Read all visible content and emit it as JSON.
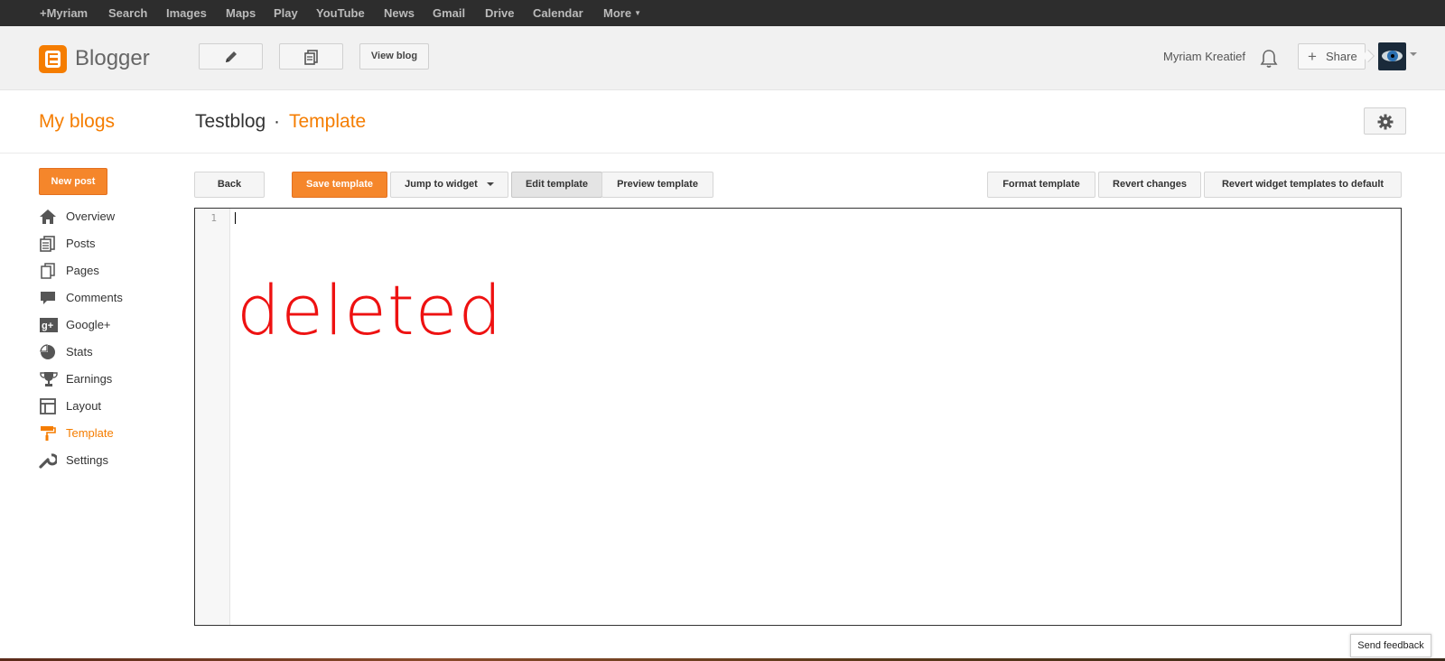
{
  "gbar": {
    "items": [
      "+Myriam",
      "Search",
      "Images",
      "Maps",
      "Play",
      "YouTube",
      "News",
      "Gmail",
      "Drive",
      "Calendar",
      "More"
    ]
  },
  "header": {
    "logo_text": "Blogger",
    "view_blog": "View blog",
    "user_name": "Myriam Kreatief",
    "share_label": "Share"
  },
  "title_row": {
    "my_blogs": "My blogs",
    "blog_name": "Testblog",
    "separator": "·",
    "section": "Template"
  },
  "sidebar": {
    "new_post": "New post",
    "items": [
      {
        "label": "Overview",
        "icon": "home-icon"
      },
      {
        "label": "Posts",
        "icon": "posts-icon"
      },
      {
        "label": "Pages",
        "icon": "pages-icon"
      },
      {
        "label": "Comments",
        "icon": "comment-icon"
      },
      {
        "label": "Google+",
        "icon": "google-plus-icon"
      },
      {
        "label": "Stats",
        "icon": "pie-chart-icon"
      },
      {
        "label": "Earnings",
        "icon": "trophy-icon"
      },
      {
        "label": "Layout",
        "icon": "layout-icon"
      },
      {
        "label": "Template",
        "icon": "paint-roller-icon",
        "active": true
      },
      {
        "label": "Settings",
        "icon": "wrench-icon"
      }
    ]
  },
  "toolbar": {
    "back": "Back",
    "save": "Save template",
    "jump": "Jump to widget",
    "edit": "Edit template",
    "preview": "Preview template",
    "format": "Format template",
    "revert": "Revert changes",
    "revert_widgets": "Revert widget templates to default"
  },
  "editor": {
    "line_number": "1",
    "overlay_text": "deleted"
  },
  "feedback": "Send feedback",
  "colors": {
    "accent": "#f57d00",
    "overlay": "#ee1111",
    "gbar_bg": "#2d2d2d"
  }
}
